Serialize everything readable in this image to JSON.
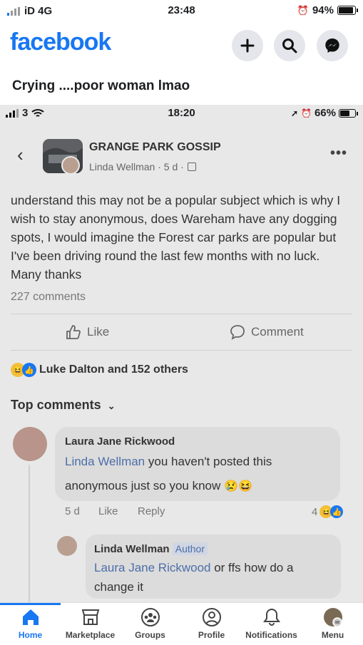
{
  "status": {
    "carrier": "iD 4G",
    "time": "23:48",
    "battery": "94%"
  },
  "header": {
    "logo": "facebook",
    "icons": [
      "plus-icon",
      "search-icon",
      "messenger-icon"
    ]
  },
  "post_caption": "Crying ....poor woman lmao",
  "screenshot": {
    "status": {
      "carrier": "3",
      "time": "18:20",
      "battery": "66%"
    },
    "group_name": "GRANGE PARK GOSSIP",
    "author_line": "Linda Wellman · 5 d ·",
    "body": "understand this may not be a popular subject which is why I wish to stay anonymous, does Wareham have any dogging spots, I would imagine the Forest car parks are popular but I've been driving round the last few months with no luck. Many thanks",
    "comments_count": "227 comments",
    "actions": {
      "like": "Like",
      "comment": "Comment"
    },
    "reactions_text": "Luke Dalton and 152 others",
    "top_comments_label": "Top comments",
    "comment1": {
      "name": "Laura Jane Rickwood",
      "mention": "Linda Wellman",
      "text_line1": " you haven't posted this",
      "text_line2": "anonymous just so you know",
      "time": "5 d",
      "like": "Like",
      "reply": "Reply",
      "reaction_count": "4"
    },
    "reply1": {
      "name": "Linda Wellman",
      "tag": "Author",
      "mention": "Laura Jane Rickwood",
      "text_line1": " or ffs how do a",
      "text_line2": "change it"
    }
  },
  "tabbar": {
    "items": [
      {
        "label": "Home",
        "icon": "home-icon"
      },
      {
        "label": "Marketplace",
        "icon": "marketplace-icon"
      },
      {
        "label": "Groups",
        "icon": "groups-icon"
      },
      {
        "label": "Profile",
        "icon": "profile-icon"
      },
      {
        "label": "Notifications",
        "icon": "bell-icon"
      },
      {
        "label": "Menu",
        "icon": "menu-avatar-icon"
      }
    ]
  },
  "colors": {
    "brand": "#1877f2",
    "mention": "#4d6ea8",
    "screenshot_bg": "#e8e8e8"
  }
}
